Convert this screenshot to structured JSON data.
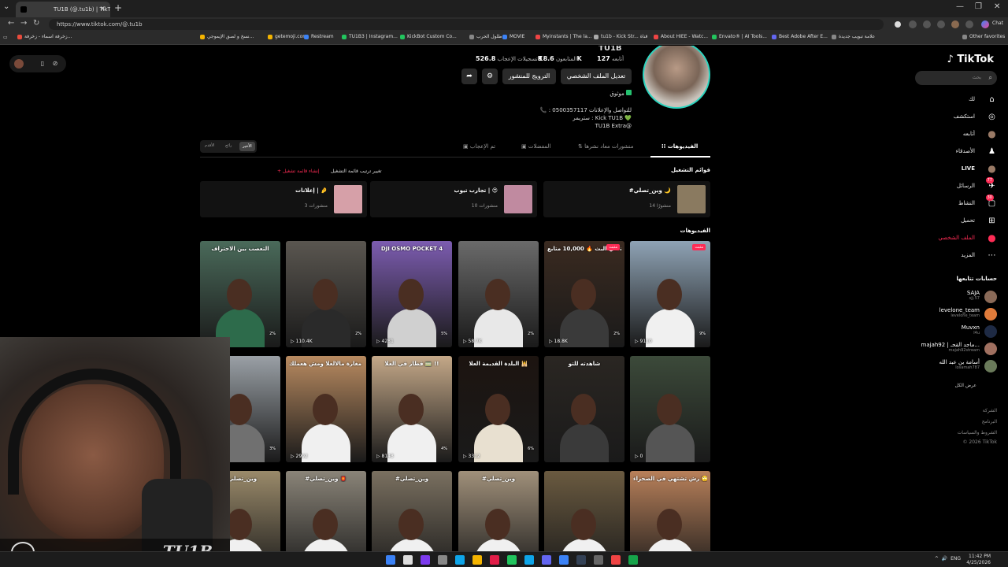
{
  "browser": {
    "tab_title": "TU1B (@.tu1b) | TikTok",
    "url": "https://www.tiktok.com/@.tu1b",
    "new_tab": "+",
    "window_controls": [
      "—",
      "❐",
      "✕"
    ],
    "chat_label": "Chat",
    "bookmarks": [
      {
        "label": "زخرفة اسماء - زخرفة...",
        "color": "#e94b3c"
      },
      {
        "label": "نسخ و لصق الإيموجي...",
        "color": "#f4b400"
      },
      {
        "label": "getemoji.com",
        "color": "#f4b400"
      },
      {
        "label": "Restream",
        "color": "#3b82f6"
      },
      {
        "label": "TU1B3 | Instagram...",
        "color": "#22c55e"
      },
      {
        "label": "KickBot Custom Co...",
        "color": "#22c55e"
      },
      {
        "label": "طلول الحرب",
        "color": "#888888"
      },
      {
        "label": "MOVIE",
        "color": "#3b82f6"
      },
      {
        "label": "Myinstants | The la...",
        "color": "#ef4444"
      },
      {
        "label": "tu1b - Kick Str... قناة",
        "color": "#aaaaaa"
      },
      {
        "label": "About HIEE - Watc...",
        "color": "#ef4444"
      },
      {
        "label": "Envato® | AI Tools...",
        "color": "#22c55e"
      },
      {
        "label": "Best Adobe After E...",
        "color": "#6366f1"
      },
      {
        "label": "علامة تبويب جديدة",
        "color": "#888888"
      }
    ],
    "other_favorites": "Other favorites"
  },
  "sidebar": {
    "logo": "TikTok",
    "search_placeholder": "بحث",
    "nav": [
      {
        "label": "لك",
        "icon": "home-icon",
        "glyph": "⌂"
      },
      {
        "label": "استكشف",
        "icon": "compass-icon",
        "glyph": "◎"
      },
      {
        "label": "أتابعه",
        "icon": "following-avatar-icon",
        "glyph": "●"
      },
      {
        "label": "الأصدقاء",
        "icon": "friends-icon",
        "glyph": "♟"
      },
      {
        "label": "LIVE",
        "icon": "live-avatar-icon",
        "glyph": "●"
      },
      {
        "label": "الرسائل",
        "icon": "messages-icon",
        "glyph": "✈",
        "badge": "77"
      },
      {
        "label": "النشاط",
        "icon": "activity-icon",
        "glyph": "▢",
        "badge": "30"
      },
      {
        "label": "تحميل",
        "icon": "upload-icon",
        "glyph": "⊞"
      },
      {
        "label": "الملف الشخصي",
        "icon": "profile-avatar-icon",
        "glyph": "●",
        "active": true
      },
      {
        "label": "المزيد",
        "icon": "more-icon",
        "glyph": "⋯"
      }
    ],
    "following_title": "حسابات تتابعها",
    "following": [
      {
        "name": "SAJA",
        "handle": "sjj.57"
      },
      {
        "name": "levelone_team",
        "handle": "levelone_team"
      },
      {
        "name": "Muvxn",
        "handle": "l4u"
      },
      {
        "name": "majah92 | ماجد القحـ...",
        "handle": "majah92stream"
      },
      {
        "name": "أسامة بن عبد الله",
        "handle": "losamah787"
      }
    ],
    "show_all": "عرض الكل",
    "footer": [
      "الشركة",
      "البرنامج",
      "الشروط والسياسات",
      "© 2026 TikTok"
    ]
  },
  "profile": {
    "username": "TU1B",
    "stats": [
      {
        "value": "127",
        "label": "أتابعه"
      },
      {
        "value": "18.6K",
        "label": "المتابعون"
      },
      {
        "value": "526.8K",
        "label": "تسجيلات الإعجاب"
      }
    ],
    "edit_button": "تعديل الملف الشخصي",
    "promote_button": "الترويج للمنشور",
    "verified_text": "موثوق",
    "bio_lines": [
      "📞 : للتواصل والإعلانات 0500357117",
      "ستريمر : Kick TU1B 💚",
      "TU1B Extra@"
    ]
  },
  "tabs": [
    {
      "label": "الفيديوهات",
      "active": true
    },
    {
      "label": "منشورات معاد نشرها",
      "active": false
    },
    {
      "label": "المفضلات",
      "active": false
    },
    {
      "label": "تم الإعجاب",
      "active": false
    }
  ],
  "sort": [
    "الأخير",
    "رائج",
    "الأقدم"
  ],
  "playlists": {
    "title": "قوائم التشغيل",
    "change_order": "تغيير ترتيب قائمة التشغيل",
    "create": "+ إنشاء قائمة تشغيل",
    "items": [
      {
        "title": "#وين_تصلي 🌙",
        "count": "14 منشورًا"
      },
      {
        "title": "تجارب تيوب | 😍",
        "count": "10 منشورات"
      },
      {
        "title": "إعلانات | 🤌",
        "count": "3 منشورات"
      }
    ]
  },
  "videos_title": "الفيديوهات",
  "videos": [
    {
      "caption": "",
      "views": "9110",
      "pct": "9%",
      "pinned": "مثبت",
      "color": "#8fa3b5",
      "body": "#f0f0f0"
    },
    {
      "caption": "أقوى لحظة في البث 🔥 10,000 متابع !",
      "views": "18.8K",
      "pct": "2%",
      "pinned": "مثبت",
      "color": "#3a2a20",
      "body": "#3a3a3a"
    },
    {
      "caption": "",
      "views": "58.7K",
      "pct": "2%",
      "pinned": "",
      "color": "#6a6a6a",
      "body": "#e8e8e8"
    },
    {
      "caption": "DJI OSMO POCKET 4",
      "views": "4281",
      "pct": "5%",
      "pinned": "",
      "color": "#7c5cb0",
      "body": "#d0d0d0"
    },
    {
      "caption": "",
      "views": "110.4K",
      "pct": "2%",
      "pinned": "",
      "color": "#5a5650",
      "body": "#2a2a2a"
    },
    {
      "caption": "التعصب بين الاحتراف",
      "views": "6993",
      "pct": "2%",
      "pinned": "",
      "color": "#4a6a5a",
      "body": "#2d6b4b"
    },
    {
      "caption": "",
      "views": "0",
      "pct": "",
      "pinned": "",
      "color": "#3c4a3a",
      "body": "#555555"
    },
    {
      "caption": "شاهدته للتو",
      "views": "",
      "pct": "",
      "pinned": "",
      "color": "#2a2622",
      "body": "#3a3a3a"
    },
    {
      "caption": "البلدة القديمة العلا 🕌",
      "views": "3312",
      "pct": "6%",
      "pinned": "",
      "color": "#1c1410",
      "body": "#e8e0d0"
    },
    {
      "caption": "قطار في العلا 🚃 !!",
      "views": "8143",
      "pct": "4%",
      "pinned": "",
      "color": "#c4a888",
      "body": "#f0f0f0"
    },
    {
      "caption": "دعطك مغارة مالالعلا ومش هعملك 😂",
      "views": "2992",
      "pct": "",
      "pinned": "",
      "color": "#b88a60",
      "body": "#f0f0f0"
    },
    {
      "caption": "",
      "views": "4838",
      "pct": "3%",
      "pinned": "",
      "color": "#9aa0a6",
      "body": "#707070"
    },
    {
      "caption": "رش تشتهي في الصحراء 🙄😂",
      "views": "",
      "pct": "",
      "pinned": "",
      "color": "#b8805a",
      "body": "#f0f0f0"
    },
    {
      "caption": "",
      "views": "",
      "pct": "",
      "pinned": "",
      "color": "#6a5a40",
      "body": "#f0f0f0"
    },
    {
      "caption": "#وين_تصلي",
      "views": "",
      "pct": "",
      "pinned": "",
      "color": "#a0907a",
      "body": "#f0f0f0"
    },
    {
      "caption": "#وين_تصلي",
      "views": "",
      "pct": "",
      "pinned": "",
      "color": "#7a7060",
      "body": "#f0f0f0"
    },
    {
      "caption": "#وين_تصلي 🏮",
      "views": "",
      "pct": "",
      "pinned": "",
      "color": "#8a8478",
      "body": "#f0f0f0"
    },
    {
      "caption": "#وين_تصلي",
      "views": "",
      "pct": "",
      "pinned": "",
      "color": "#9a8a6a",
      "body": "#f0f0f0"
    }
  ],
  "webcam": {
    "overlay_name": "TU1B"
  },
  "taskbar": {
    "lang": "ENG",
    "time": "11:42 PM",
    "date": "4/25/2026"
  }
}
